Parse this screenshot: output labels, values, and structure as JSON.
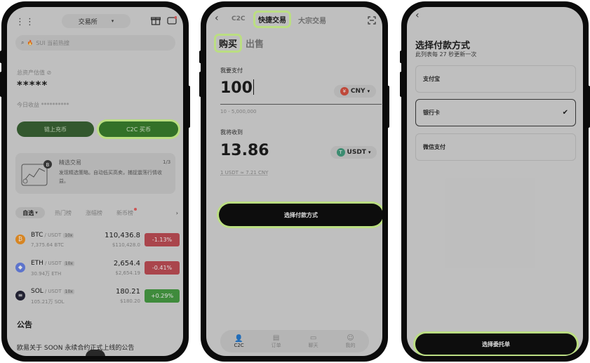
{
  "phone1": {
    "title": "交易所",
    "search_placeholder": "SUI 当前热搜",
    "assets_label": "总资产估值",
    "assets_value": "*****",
    "today_label": "今日收益",
    "today_value": "**********",
    "btn_onchain": "链上充币",
    "btn_c2c": "C2C 买币",
    "promo_title": "精选交易",
    "promo_text": "发现精选策略。自动低买高卖，捕捉震荡行情收益。",
    "promo_page": "1/3",
    "tabs": [
      "自选",
      "热门榜",
      "涨幅榜",
      "新币榜"
    ],
    "coins": [
      {
        "sym": "BTC",
        "quote": "/ USDT",
        "lev": "10x",
        "vol": "7,375.64 BTC",
        "price": "110,436.8",
        "fiat": "$110,428.0",
        "change": "-1.13%",
        "up": false,
        "color": "#f7931a",
        "icon": "₿"
      },
      {
        "sym": "ETH",
        "quote": "/ USDT",
        "lev": "10x",
        "vol": "30.94万 ETH",
        "price": "2,654.4",
        "fiat": "$2,654.19",
        "change": "-0.41%",
        "up": false,
        "color": "#627eea",
        "icon": "◆"
      },
      {
        "sym": "SOL",
        "quote": "/ USDT",
        "lev": "10x",
        "vol": "105.21万 SOL",
        "price": "180.21",
        "fiat": "$180.20",
        "change": "+0.29%",
        "up": true,
        "color": "#1a1a2e",
        "icon": "≡"
      }
    ],
    "announcement_title": "公告",
    "announcement_text": "欧易关于 SOON 永续合约正式上线的公告"
  },
  "phone2": {
    "tabs": [
      "C2C",
      "快捷交易",
      "大宗交易"
    ],
    "buy": "购买",
    "sell": "出售",
    "pay_label": "我要支付",
    "pay_value": "100",
    "pay_currency": "CNY",
    "pay_range": "10 - 5,000,000",
    "receive_label": "我将收到",
    "receive_value": "13.86",
    "receive_currency": "USDT",
    "rate": "1 USDT ≈ 7.21 CNY",
    "cta": "选择付款方式",
    "nav": [
      "C2C",
      "订单",
      "聊天",
      "我的"
    ]
  },
  "phone3": {
    "title": "选择付款方式",
    "subtitle": "此列表每 27 秒更新一次",
    "methods": [
      "支付宝",
      "银行卡",
      "微信支付"
    ],
    "selected_index": 1,
    "cta": "选择委托单"
  }
}
